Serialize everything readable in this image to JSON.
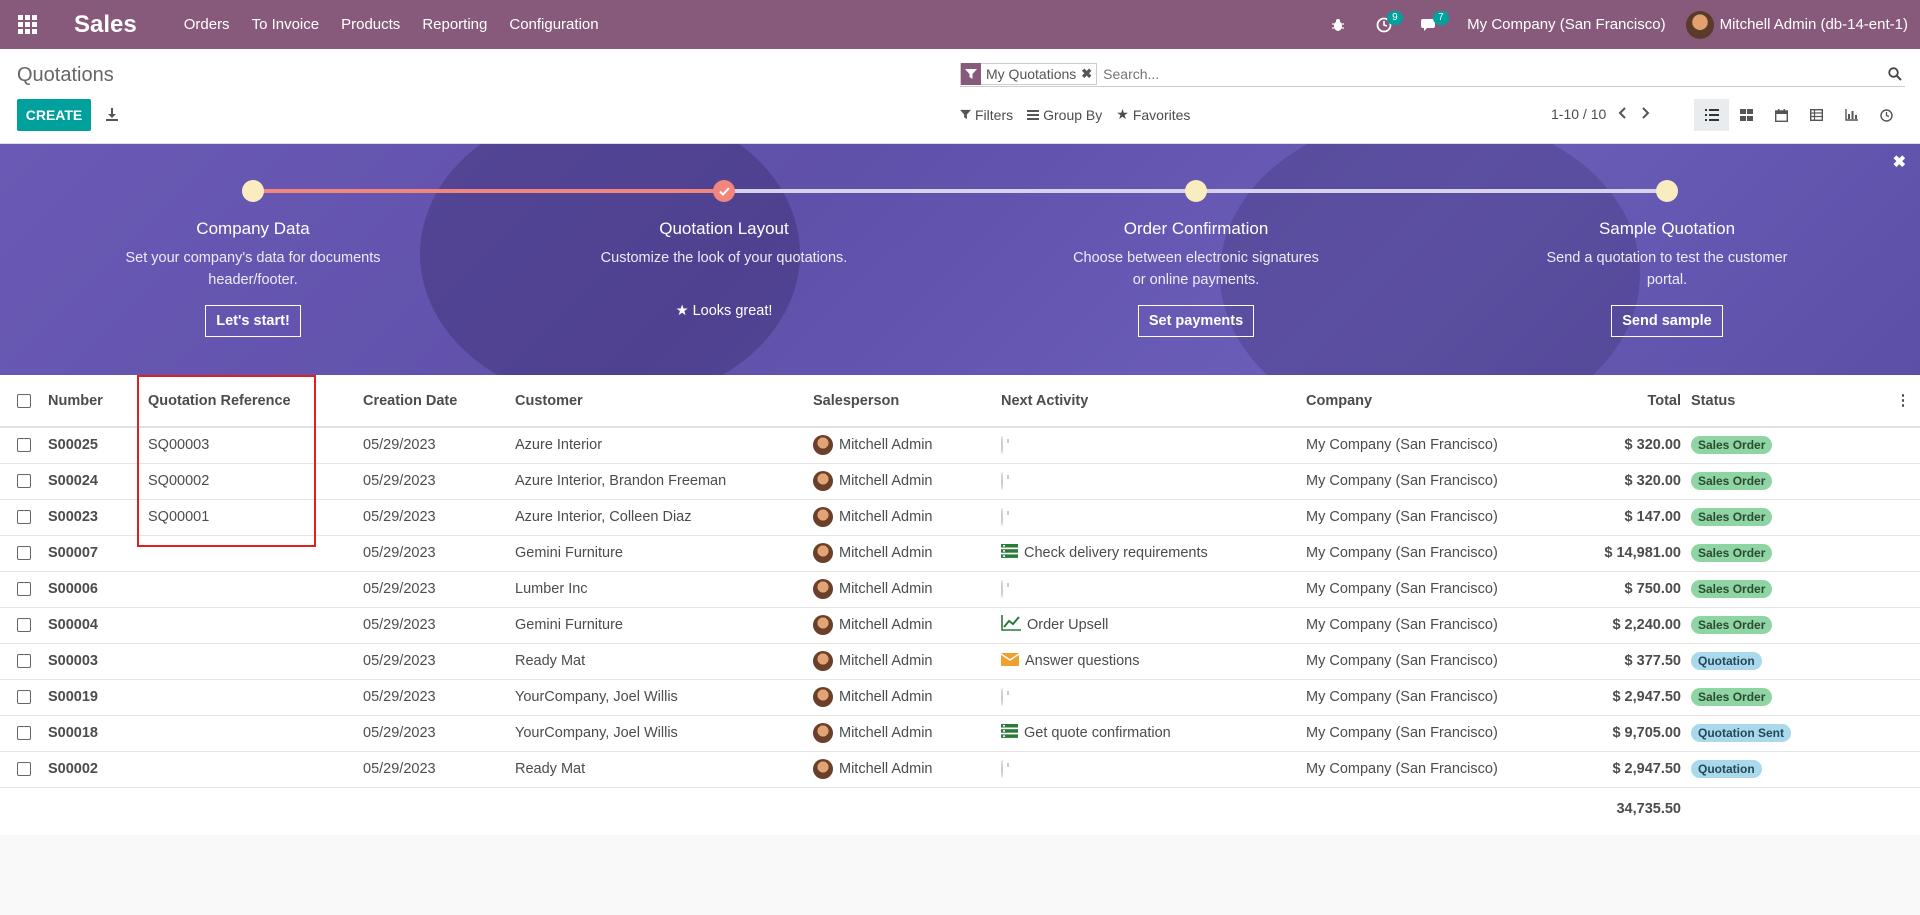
{
  "navbar": {
    "brand": "Sales",
    "menu": [
      "Orders",
      "To Invoice",
      "Products",
      "Reporting",
      "Configuration"
    ],
    "activity_count": "9",
    "messages_count": "7",
    "company": "My Company (San Francisco)",
    "user": "Mitchell Admin (db-14-ent-1)"
  },
  "control_panel": {
    "breadcrumb": "Quotations",
    "create_label": "CREATE",
    "facet_label": "My Quotations",
    "search_placeholder": "Search...",
    "filters_label": "Filters",
    "groupby_label": "Group By",
    "favorites_label": "Favorites",
    "pager_value": "1-10 / 10"
  },
  "banner": {
    "steps": [
      {
        "title": "Company Data",
        "desc": "Set your company's data for documents header/footer.",
        "button": "Let's start!"
      },
      {
        "title": "Quotation Layout",
        "desc": "Customize the look of your quotations.",
        "done": "Looks great!"
      },
      {
        "title": "Order Confirmation",
        "desc": "Choose between electronic signatures or online payments.",
        "button": "Set payments"
      },
      {
        "title": "Sample Quotation",
        "desc": "Send a quotation to test the customer portal.",
        "button": "Send sample"
      }
    ]
  },
  "table": {
    "headers": {
      "number": "Number",
      "quotation_reference": "Quotation Reference",
      "creation_date": "Creation Date",
      "customer": "Customer",
      "salesperson": "Salesperson",
      "next_activity": "Next Activity",
      "company": "Company",
      "total": "Total",
      "status": "Status"
    },
    "rows": [
      {
        "number": "S00025",
        "ref": "SQ00003",
        "date": "05/29/2023",
        "customer": "Azure Interior",
        "salesperson": "Mitchell Admin",
        "activity": "",
        "activity_icon": "clock-icon",
        "company": "My Company (San Francisco)",
        "total": "$ 320.00",
        "status": "Sales Order"
      },
      {
        "number": "S00024",
        "ref": "SQ00002",
        "date": "05/29/2023",
        "customer": "Azure Interior, Brandon Freeman",
        "salesperson": "Mitchell Admin",
        "activity": "",
        "activity_icon": "clock-icon",
        "company": "My Company (San Francisco)",
        "total": "$ 320.00",
        "status": "Sales Order"
      },
      {
        "number": "S00023",
        "ref": "SQ00001",
        "date": "05/29/2023",
        "customer": "Azure Interior, Colleen Diaz",
        "salesperson": "Mitchell Admin",
        "activity": "",
        "activity_icon": "clock-icon",
        "company": "My Company (San Francisco)",
        "total": "$ 147.00",
        "status": "Sales Order"
      },
      {
        "number": "S00007",
        "ref": "",
        "date": "05/29/2023",
        "customer": "Gemini Furniture",
        "salesperson": "Mitchell Admin",
        "activity": "Check delivery requirements",
        "activity_icon": "tasks-icon",
        "company": "My Company (San Francisco)",
        "total": "$ 14,981.00",
        "status": "Sales Order"
      },
      {
        "number": "S00006",
        "ref": "",
        "date": "05/29/2023",
        "customer": "Lumber Inc",
        "salesperson": "Mitchell Admin",
        "activity": "",
        "activity_icon": "clock-icon",
        "company": "My Company (San Francisco)",
        "total": "$ 750.00",
        "status": "Sales Order"
      },
      {
        "number": "S00004",
        "ref": "",
        "date": "05/29/2023",
        "customer": "Gemini Furniture",
        "salesperson": "Mitchell Admin",
        "activity": "Order Upsell",
        "activity_icon": "line-chart-icon",
        "company": "My Company (San Francisco)",
        "total": "$ 2,240.00",
        "status": "Sales Order"
      },
      {
        "number": "S00003",
        "ref": "",
        "date": "05/29/2023",
        "customer": "Ready Mat",
        "salesperson": "Mitchell Admin",
        "activity": "Answer questions",
        "activity_icon": "envelope-icon",
        "company": "My Company (San Francisco)",
        "total": "$ 377.50",
        "status": "Quotation"
      },
      {
        "number": "S00019",
        "ref": "",
        "date": "05/29/2023",
        "customer": "YourCompany, Joel Willis",
        "salesperson": "Mitchell Admin",
        "activity": "",
        "activity_icon": "clock-icon",
        "company": "My Company (San Francisco)",
        "total": "$ 2,947.50",
        "status": "Sales Order"
      },
      {
        "number": "S00018",
        "ref": "",
        "date": "05/29/2023",
        "customer": "YourCompany, Joel Willis",
        "salesperson": "Mitchell Admin",
        "activity": "Get quote confirmation",
        "activity_icon": "tasks-icon",
        "company": "My Company (San Francisco)",
        "total": "$ 9,705.00",
        "status": "Quotation Sent"
      },
      {
        "number": "S00002",
        "ref": "",
        "date": "05/29/2023",
        "customer": "Ready Mat",
        "salesperson": "Mitchell Admin",
        "activity": "",
        "activity_icon": "clock-icon",
        "company": "My Company (San Francisco)",
        "total": "$ 2,947.50",
        "status": "Quotation"
      }
    ],
    "footer_total": "34,735.50"
  },
  "colors": {
    "navbar": "#875a7b",
    "primary": "#00a09d",
    "banner": "#6a5ab5",
    "progress_done": "#f2867d",
    "highlight": "#e02020"
  }
}
